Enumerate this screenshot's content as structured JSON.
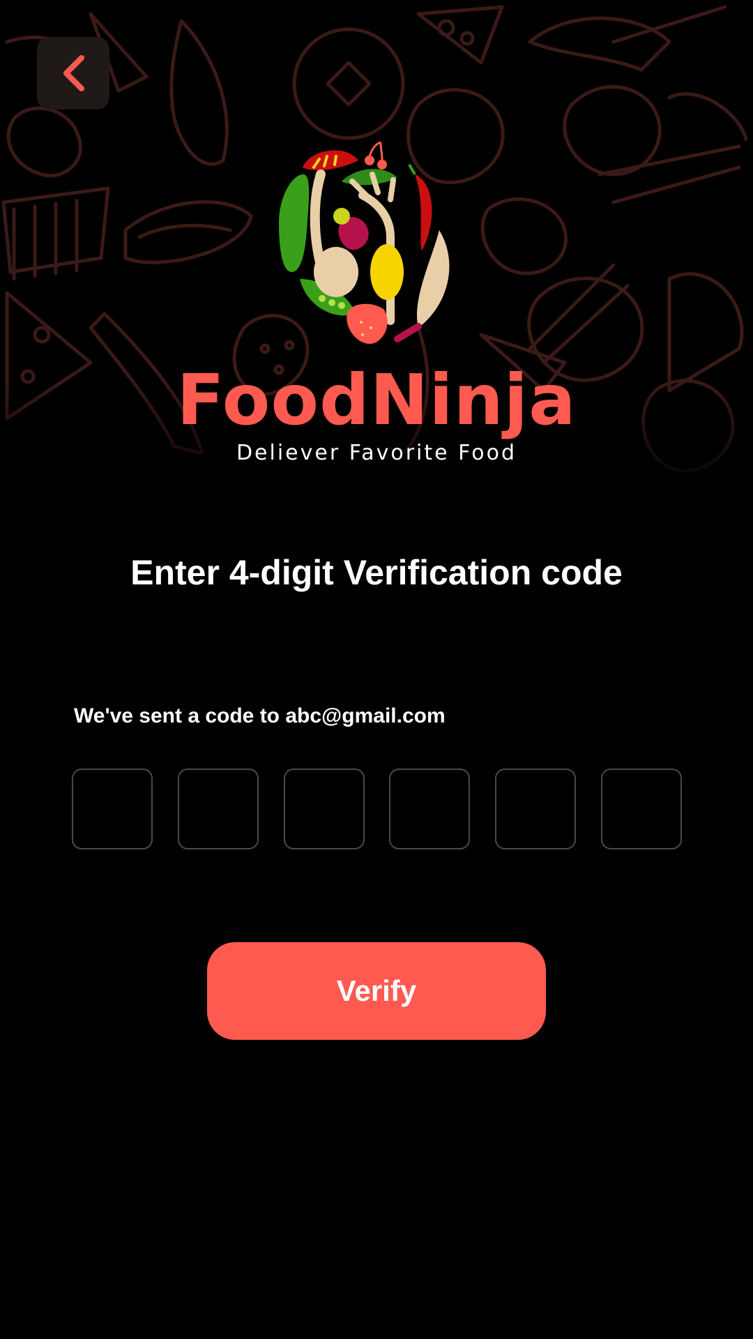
{
  "brand": {
    "name": "FoodNinja",
    "tagline": "Deliever Favorite Food"
  },
  "colors": {
    "accent": "#ff5a50",
    "background": "#000000",
    "back_button_bg": "#1f1a18",
    "pattern_stroke": "#3a1a17"
  },
  "header": {
    "back_icon": "chevron-left-icon"
  },
  "main": {
    "title": "Enter 4-digit Verification code",
    "sent_note": "We've sent a code to abc@gmail.com",
    "code_digits": [
      "",
      "",
      "",
      "",
      "",
      ""
    ],
    "verify_label": "Verify"
  }
}
